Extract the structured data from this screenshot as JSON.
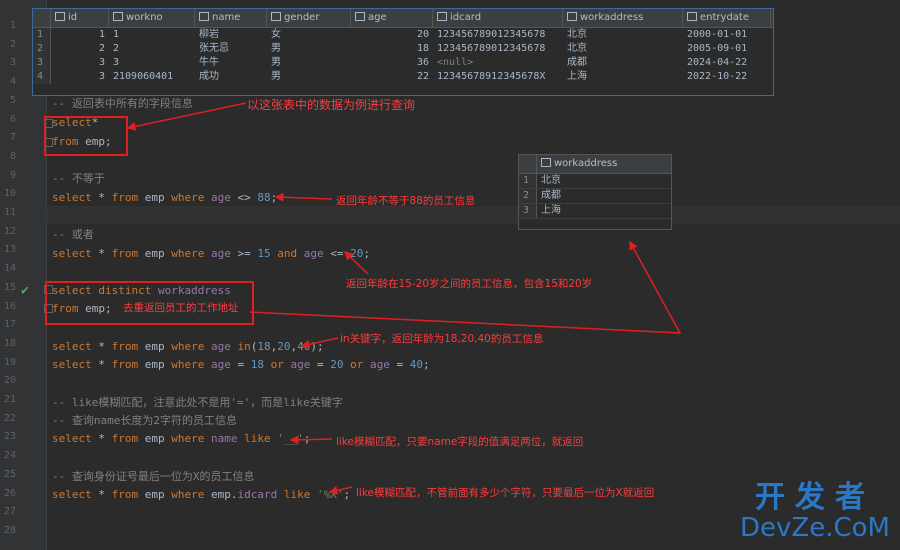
{
  "line_numbers": [
    "1",
    "2",
    "3",
    "4",
    "5",
    "6",
    "7",
    "8",
    "9",
    "10",
    "11",
    "12",
    "13",
    "14",
    "15",
    "16",
    "17",
    "18",
    "19",
    "20",
    "21",
    "22",
    "23",
    "24",
    "25",
    "26",
    "27",
    "28"
  ],
  "emp_table": {
    "columns": [
      "id",
      "workno",
      "name",
      "gender",
      "age",
      "idcard",
      "workaddress",
      "entrydate"
    ],
    "rows": [
      {
        "rn": "1",
        "id": "1",
        "workno": "1",
        "name": "柳岩",
        "gender": "女",
        "age": "20",
        "idcard": "123456789012345678",
        "workaddress": "北京",
        "entrydate": "2000-01-01"
      },
      {
        "rn": "2",
        "id": "2",
        "workno": "2",
        "name": "张无忌",
        "gender": "男",
        "age": "18",
        "idcard": "123456789012345678",
        "workaddress": "北京",
        "entrydate": "2005-09-01"
      },
      {
        "rn": "3",
        "id": "3",
        "workno": "3",
        "name": "牛牛",
        "gender": "男",
        "age": "36",
        "idcard": "<null>",
        "workaddress": "成都",
        "entrydate": "2024-04-22"
      },
      {
        "rn": "4",
        "id": "3",
        "workno": "2109060401",
        "name": "成功",
        "gender": "男",
        "age": "22",
        "idcard": "12345678912345678X",
        "workaddress": "上海",
        "entrydate": "2022-10-22"
      }
    ]
  },
  "distinct_table": {
    "column": "workaddress",
    "rows": [
      {
        "rn": "1",
        "value": "北京"
      },
      {
        "rn": "2",
        "value": "成都"
      },
      {
        "rn": "3",
        "value": "上海"
      }
    ]
  },
  "code": {
    "l6": "-- 返回表中所有的字段信息",
    "l7_kw": "select",
    "l7_rest": "*",
    "l8_kw": "from",
    "l8_rest": " emp;",
    "l10": "-- 不等于",
    "l11": {
      "a": "select",
      "b": " * ",
      "c": "from",
      "d": " emp ",
      "e": "where",
      "f": " age ",
      "g": "<>",
      "h": " ",
      "i": "88",
      "j": ";"
    },
    "l13": "-- 或者",
    "l14": {
      "a": "select",
      "b": " * ",
      "c": "from",
      "d": " emp ",
      "e": "where",
      "f": " age ",
      "g": ">=",
      "h": " ",
      "i": "15",
      "j": " ",
      "k": "and",
      "l": " age ",
      "m": "<=",
      "n": " ",
      "o": "20",
      "p": ";"
    },
    "l16": {
      "a": "select",
      "b": " ",
      "c": "distinct",
      "d": " workaddress"
    },
    "l17": {
      "a": "from",
      "b": " emp;"
    },
    "l19": {
      "a": "select",
      "b": " * ",
      "c": "from",
      "d": " emp ",
      "e": "where",
      "f": " age ",
      "g": "in",
      "h": "(",
      "i": "18",
      "j": ",",
      "k": "20",
      "l": ",",
      "m": "40",
      "n": ");"
    },
    "l20": {
      "a": "select",
      "b": " * ",
      "c": "from",
      "d": " emp ",
      "e": "where",
      "f": " age ",
      "g": "= ",
      "h": "18",
      "i": " ",
      "j": "or",
      "k": " age ",
      "l": "= ",
      "m": "20",
      "n": " ",
      "o": "or",
      "p": " age ",
      "q": "= ",
      "r": "40",
      "s": ";"
    },
    "l22": "-- like模糊匹配，注意此处不是用'='，而是like关键字",
    "l23": "-- 查询name长度为2字符的员工信息",
    "l24": {
      "a": "select",
      "b": " * ",
      "c": "from",
      "d": " emp ",
      "e": "where",
      "f": " name ",
      "g": "like",
      "h": " ",
      "i": "'__'",
      "j": ";"
    },
    "l26": "-- 查询身份证号最后一位为X的员工信息",
    "l27": {
      "a": "select",
      "b": " * ",
      "c": "from",
      "d": " emp ",
      "e": "where",
      "f": " emp.",
      "g": "idcard",
      "h": " ",
      "i": "like",
      "j": " ",
      "k": "'%X'",
      "l": ";"
    }
  },
  "notes": {
    "n1": "以这张表中的数据为例进行查询",
    "n2": "返回年龄不等于88的员工信息",
    "n3": "返回年龄在15-20岁之间的员工信息，包含15和20岁",
    "n4": "去重返回员工的工作地址",
    "n5": "in关键字，返回年龄为18,20,40的员工信息",
    "n6": "like模糊匹配，只要name字段的值满足两位，就返回",
    "n7": "like模糊匹配，不管前面有多少个字符，只要最后一位为X就返回"
  },
  "watermark": {
    "cn": "开发者",
    "en": "DevZe.CoM"
  },
  "colors": {
    "keyword": "#cc7832",
    "comment": "#808080",
    "number": "#6897bb",
    "string": "#6a8759",
    "annotation": "#ff3b3b",
    "watermark": "#2a78c8"
  }
}
